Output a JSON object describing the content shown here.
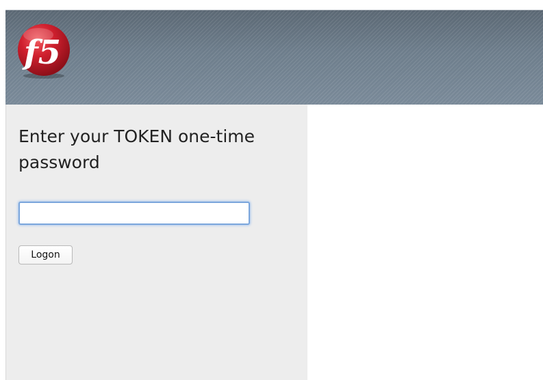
{
  "header": {
    "logo_text": "f5",
    "logo_icon": "f5-logo-icon",
    "background_color": "#6f7f8d"
  },
  "login": {
    "prompt": "Enter your TOKEN one-time password",
    "password_value": "",
    "logon_label": "Logon"
  },
  "colors": {
    "panel_background": "#ededed",
    "logo_red": "#d0202e",
    "input_focus": "#7ba6dc"
  }
}
